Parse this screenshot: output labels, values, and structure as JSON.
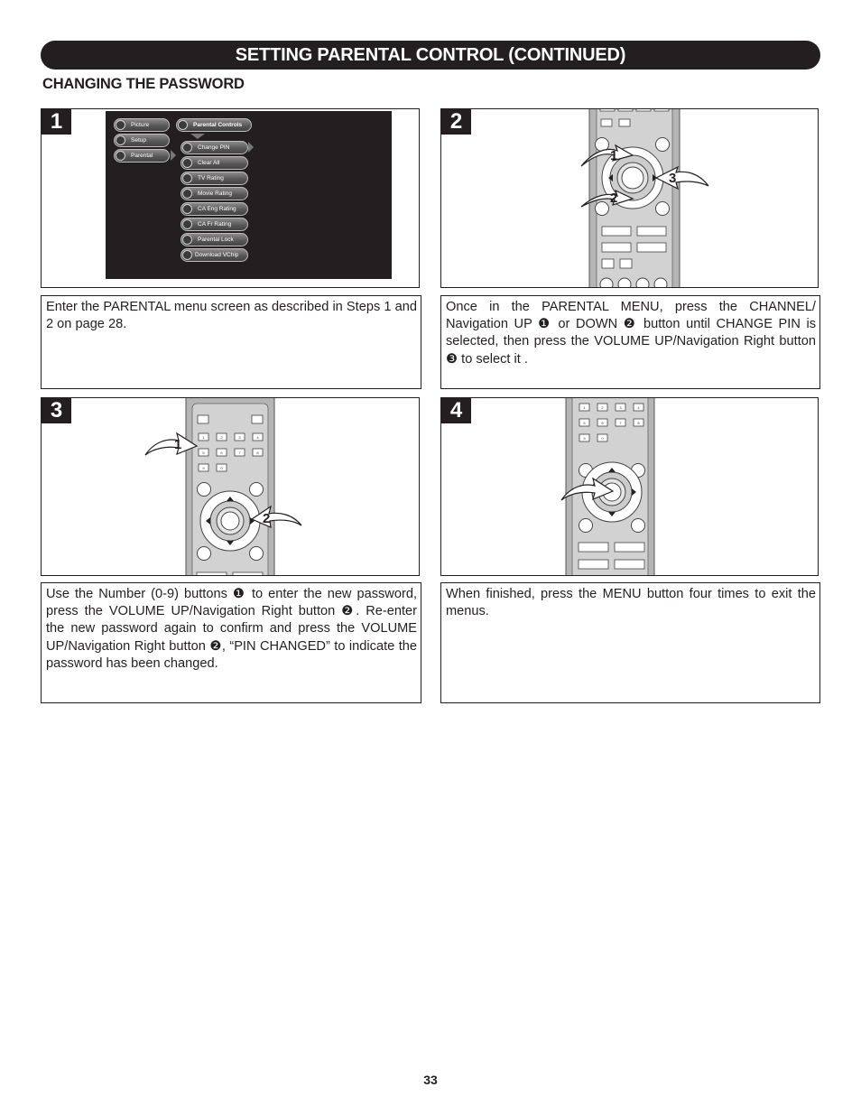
{
  "header": {
    "title": "SETTING PARENTAL CONTROL (CONTINUED)",
    "subtitle": "CHANGING THE PASSWORD"
  },
  "steps": [
    {
      "number": "1",
      "image": "tv-menu-screen",
      "text": "Enter the PARENTAL menu screen as described in Steps 1 and 2 on page 28."
    },
    {
      "number": "2",
      "image": "remote-navigation",
      "callouts": [
        "1",
        "2",
        "3"
      ],
      "text": "Once in the PARENTAL MENU, press the CHANNEL/ Navigation UP ❶ or DOWN ❷ button until CHANGE PIN is selected, then press the VOLUME UP/Navigation Right button ❸  to select it ."
    },
    {
      "number": "3",
      "image": "remote-number-pad",
      "callouts": [
        "1",
        "2"
      ],
      "text": "Use the Number (0-9) buttons ❶ to enter the new password, press the VOLUME UP/Navigation Right button ❷. Re-enter the new password again to confirm and press the VOLUME UP/Navigation Right button ❷, “PIN CHANGED” to indicate the password has been changed."
    },
    {
      "number": "4",
      "image": "remote-enter",
      "text": "When finished, press the MENU button four times to exit the menus."
    }
  ],
  "tv_menu": {
    "main_items": [
      "Picture",
      "Setup",
      "Parental"
    ],
    "submenu_title": "Parental Controls",
    "submenu_items": [
      "Change PIN",
      "Clear All",
      "TV Rating",
      "Movie Rating",
      "CA Eng Rating",
      "CA Fr Rating",
      "Parental Lock",
      "Download VChip"
    ],
    "selected_item": "Change PIN"
  },
  "remote_keys": {
    "row1": [
      "1",
      "2",
      "3",
      "4"
    ],
    "row2": [
      "5",
      "6",
      "7",
      "8"
    ],
    "row3": [
      "9",
      "0"
    ]
  },
  "footer": {
    "page_number": "33"
  },
  "colors": {
    "ink": "#231f20",
    "remote_body": "#b5b5b5",
    "remote_panel": "#d2d2d2"
  }
}
